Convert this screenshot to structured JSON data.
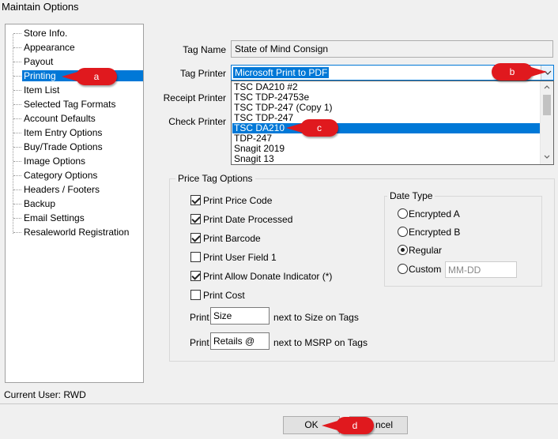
{
  "window": {
    "title": "Maintain Options"
  },
  "tree": {
    "items": [
      {
        "label": "Store Info."
      },
      {
        "label": "Appearance"
      },
      {
        "label": "Payout"
      },
      {
        "label": "Printing"
      },
      {
        "label": "Item List"
      },
      {
        "label": "Selected Tag Formats"
      },
      {
        "label": "Account Defaults"
      },
      {
        "label": "Item Entry Options"
      },
      {
        "label": "Buy/Trade Options"
      },
      {
        "label": "Image Options"
      },
      {
        "label": "Category Options"
      },
      {
        "label": "Headers / Footers"
      },
      {
        "label": "Backup"
      },
      {
        "label": "Email Settings"
      },
      {
        "label": "Resaleworld Registration"
      }
    ],
    "selected": "Printing"
  },
  "form": {
    "tag_name_label": "Tag Name",
    "tag_name_value": "State of Mind Consign",
    "tag_printer_label": "Tag Printer",
    "tag_printer_value": "Microsoft Print to PDF",
    "receipt_printer_label": "Receipt Printer",
    "check_printer_label": "Check Printer"
  },
  "dropdown": {
    "options": [
      "TSC DA210 #2",
      "TSC TDP-24753e",
      "TSC TDP-247 (Copy 1)",
      "TSC TDP-247",
      "TSC DA210",
      "TDP-247",
      "Snagit 2019",
      "Snagit 13"
    ],
    "highlighted": "TSC DA210"
  },
  "price_tag_options": {
    "title": "Price Tag Options",
    "checkboxes": [
      {
        "label": "Print Price Code",
        "checked": true
      },
      {
        "label": "Print Date Processed",
        "checked": true
      },
      {
        "label": "Print Barcode",
        "checked": true
      },
      {
        "label": "Print User Field 1",
        "checked": false
      },
      {
        "label": "Print Allow Donate Indicator (*)",
        "checked": true
      },
      {
        "label": "Print Cost",
        "checked": false
      }
    ],
    "print_label": "Print",
    "size_value": "Size",
    "size_suffix": "next to Size on Tags",
    "retails_value": "Retails @",
    "retails_suffix": "next to MSRP on Tags"
  },
  "date_type": {
    "title": "Date Type",
    "options": [
      {
        "label": "Encrypted A",
        "selected": false
      },
      {
        "label": "Encrypted B",
        "selected": false
      },
      {
        "label": "Regular",
        "selected": true
      },
      {
        "label": "Custom",
        "selected": false
      }
    ],
    "custom_placeholder": "MM-DD"
  },
  "footer": {
    "current_user": "Current User: RWD",
    "ok_label": "OK",
    "cancel_label": "ncel"
  },
  "callouts": {
    "a": "a",
    "b": "b",
    "c": "c",
    "d": "d"
  },
  "colors": {
    "selection": "#0078d7",
    "callout": "#e0191e"
  }
}
